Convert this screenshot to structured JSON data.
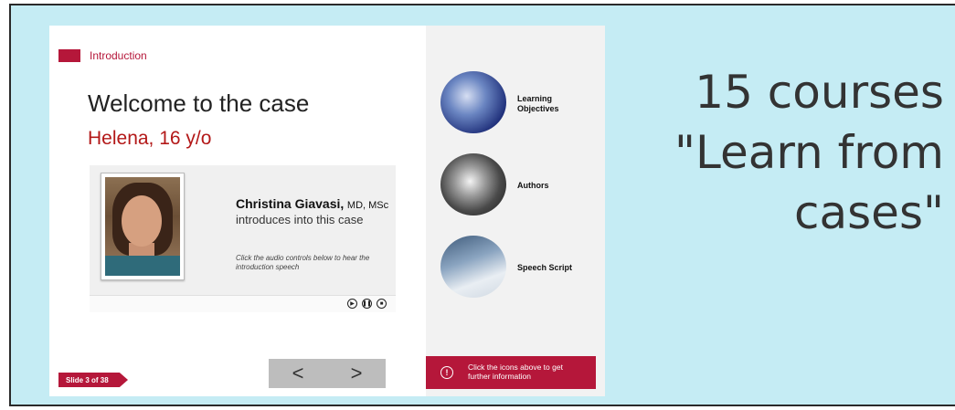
{
  "slide": {
    "section": "Introduction",
    "title": "Welcome to the case",
    "subtitle": "Helena, 16 y/o",
    "presenter": {
      "name": "Christina Giavasi,",
      "credentials": "MD, MSc",
      "tagline": "introduces into this case",
      "audio_hint": "Click the audio controls below to hear the introduction speech"
    },
    "audio_controls": [
      "play-icon",
      "pause-icon",
      "stop-icon"
    ],
    "counter": "Slide 3 of 38",
    "nav": {
      "prev": "<",
      "next": ">"
    },
    "side_menu": [
      {
        "label": "Learning Objectives",
        "icon": "dna-helix-image"
      },
      {
        "label": "Authors",
        "icon": "portrait-image"
      },
      {
        "label": "Speech Script",
        "icon": "writing-hand-image"
      }
    ],
    "info_bar": {
      "text": "Click the icons above to get further information",
      "icon": "!"
    }
  },
  "headline": {
    "line1": "15 courses",
    "line2": "\"Learn from",
    "line3": "cases\""
  },
  "colors": {
    "accent": "#b5173a",
    "background": "#c5ecf4",
    "subtitle": "#b31818"
  }
}
